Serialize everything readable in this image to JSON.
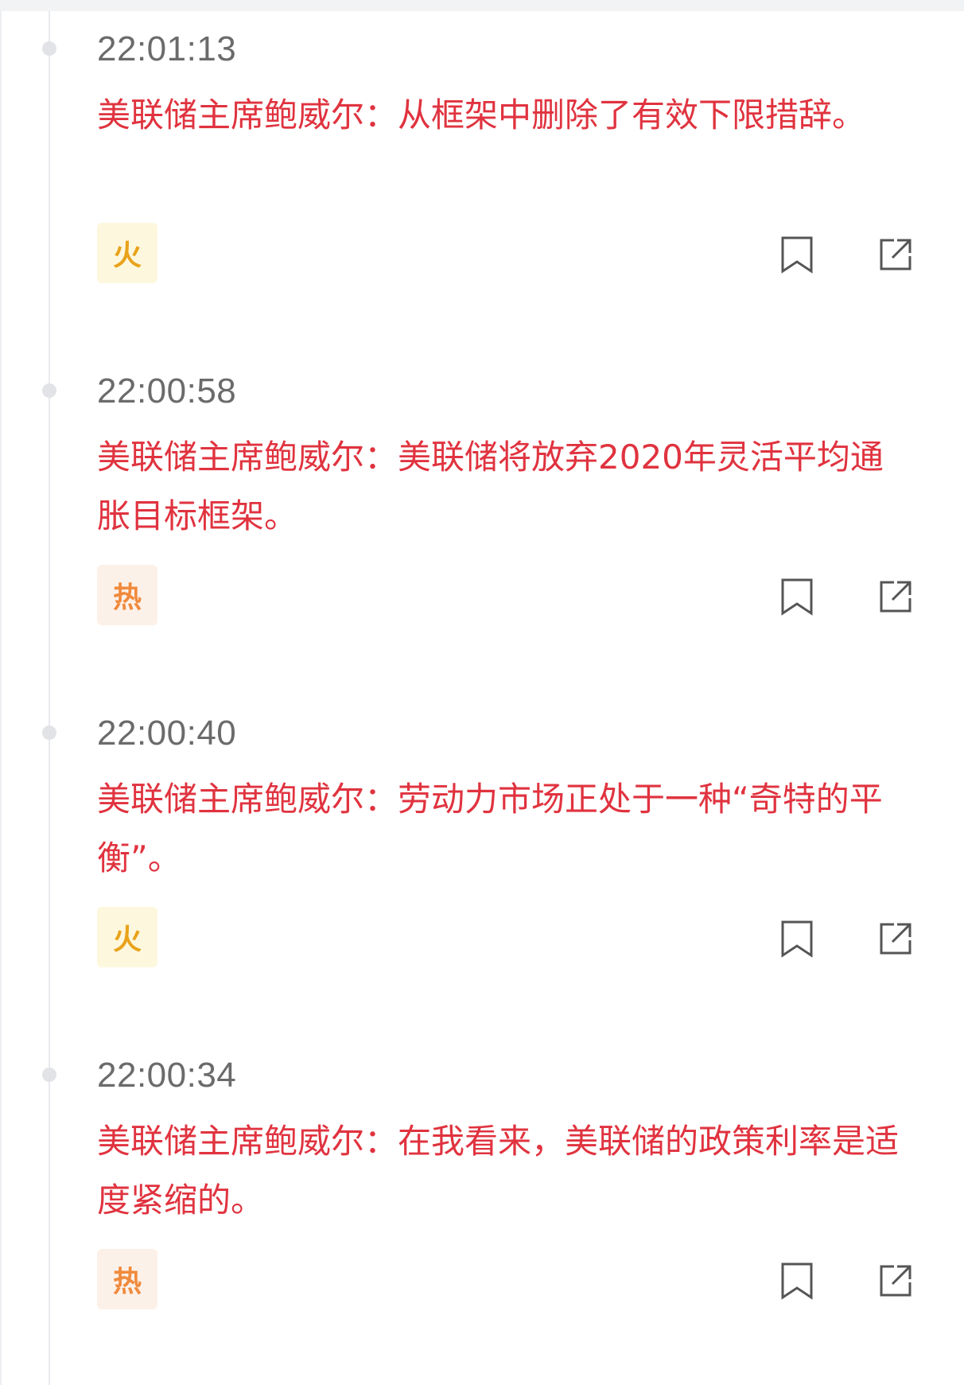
{
  "feed": {
    "items": [
      {
        "time": "22:01:13",
        "headline": "美联储主席鲍威尔：从框架中删除了有效下限措辞。",
        "badge": "火",
        "badge_type": "fire"
      },
      {
        "time": "22:00:58",
        "headline": "美联储主席鲍威尔：美联储将放弃2020年灵活平均通胀目标框架。",
        "badge": "热",
        "badge_type": "hot"
      },
      {
        "time": "22:00:40",
        "headline": "美联储主席鲍威尔：劳动力市场正处于一种“奇特的平衡”。",
        "badge": "火",
        "badge_type": "fire"
      },
      {
        "time": "22:00:34",
        "headline": "美联储主席鲍威尔：在我看来，美联储的政策利率是适度紧缩的。",
        "badge": "热",
        "badge_type": "hot"
      }
    ]
  },
  "colors": {
    "headline": "#e0333f",
    "time": "#6b6b6b",
    "fire_badge_bg": "#fdf7dd",
    "fire_badge_text": "#e9a21a",
    "hot_badge_bg": "#fcf1e9",
    "hot_badge_text": "#f08a3c",
    "icon": "#555555"
  },
  "icons": {
    "bookmark": "bookmark-icon",
    "share": "share-icon"
  }
}
